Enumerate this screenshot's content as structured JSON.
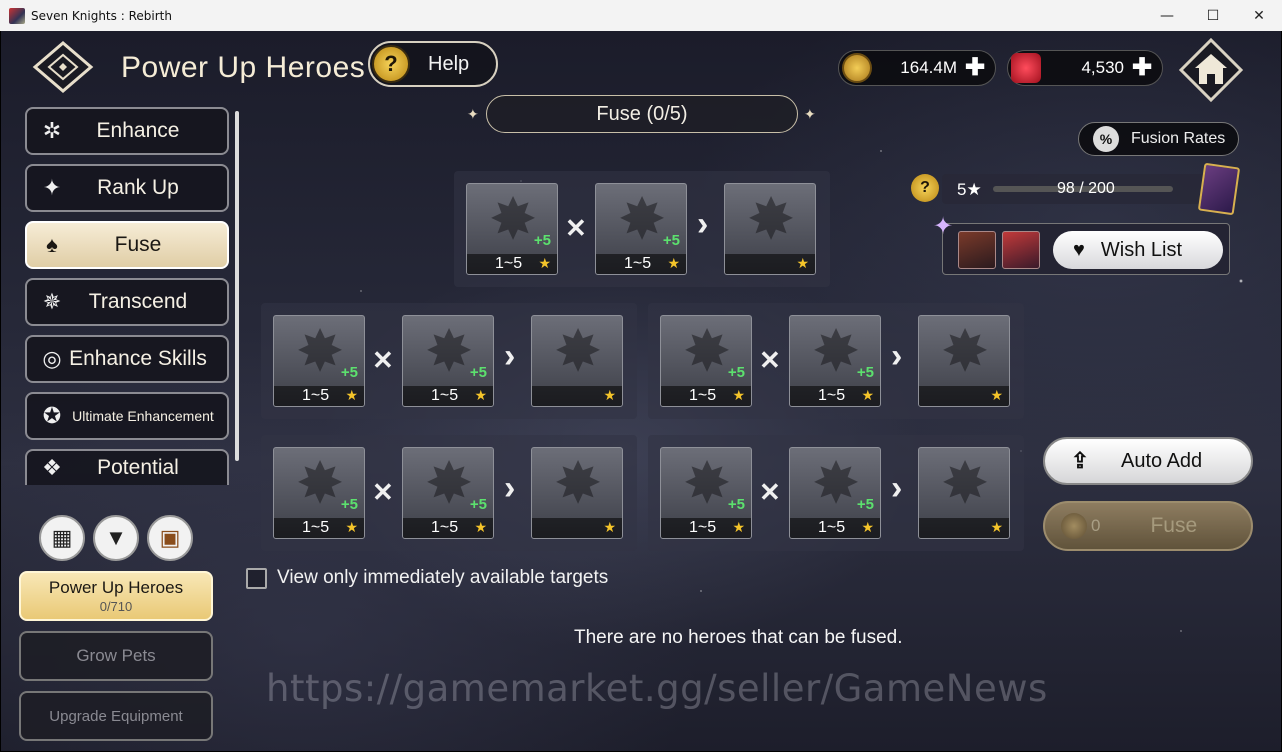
{
  "window": {
    "title": "Seven Knights : Rebirth",
    "controls": [
      "—",
      "☐",
      "✕"
    ]
  },
  "header": {
    "title": "Power Up Heroes",
    "help_label": "Help",
    "help_icon": "?"
  },
  "currency": {
    "gold": "164.4M",
    "ruby": "4,530",
    "plus": "✚"
  },
  "fuse": {
    "header": "Fuse (0/5)",
    "fusion_rates_label": "Fusion Rates",
    "fusion_rates_icon": "%",
    "progress_stars": "5★",
    "progress_count": "98 / 200",
    "progress_fraction": 0.49,
    "wish_list_label": "Wish List",
    "slot_range": "1~5",
    "slot_star": "★",
    "slot_plus": "+5",
    "op_cross": "✕",
    "op_arrow": "›",
    "view_only_label": "View only immediately available targets",
    "empty_message": "There are no heroes that can be fused.",
    "auto_add_label": "Auto Add",
    "fuse_button_label": "Fuse",
    "fuse_cost": "0"
  },
  "sidebar": {
    "items": [
      {
        "label": "Enhance",
        "icon": "✲"
      },
      {
        "label": "Rank Up",
        "icon": "✦"
      },
      {
        "label": "Fuse",
        "icon": "♠"
      },
      {
        "label": "Transcend",
        "icon": "✵"
      },
      {
        "label": "Enhance Skills",
        "icon": "◎"
      },
      {
        "label": "Ultimate Enhancement",
        "icon": "✪"
      },
      {
        "label": "Potential",
        "icon": "❖"
      }
    ]
  },
  "bottom_tabs": {
    "power_up": {
      "label": "Power Up Heroes",
      "count": "0/710"
    },
    "grow_pets": {
      "label": "Grow Pets"
    },
    "upgrade_equipment": {
      "label": "Upgrade Equipment"
    }
  },
  "toolbar_icons": {
    "grid": "▦",
    "filter": "▼",
    "chest": "▣"
  },
  "watermark": "https://gamemarket.gg/seller/GameNews"
}
